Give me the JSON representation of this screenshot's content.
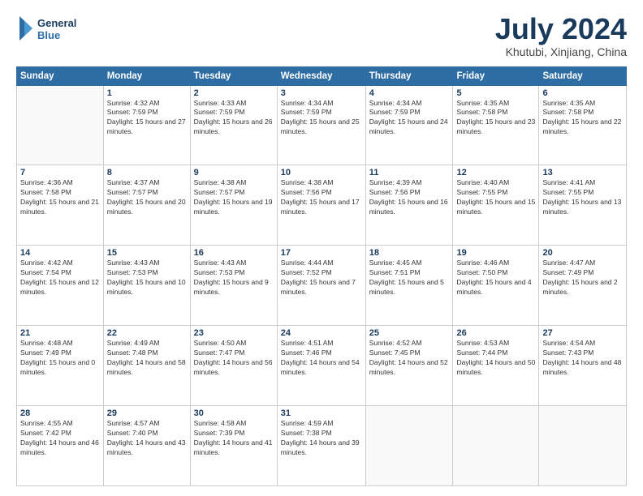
{
  "logo": {
    "line1": "General",
    "line2": "Blue"
  },
  "title": "July 2024",
  "subtitle": "Khutubi, Xinjiang, China",
  "weekdays": [
    "Sunday",
    "Monday",
    "Tuesday",
    "Wednesday",
    "Thursday",
    "Friday",
    "Saturday"
  ],
  "weeks": [
    [
      {
        "day": "",
        "sunrise": "",
        "sunset": "",
        "daylight": ""
      },
      {
        "day": "1",
        "sunrise": "Sunrise: 4:32 AM",
        "sunset": "Sunset: 7:59 PM",
        "daylight": "Daylight: 15 hours and 27 minutes."
      },
      {
        "day": "2",
        "sunrise": "Sunrise: 4:33 AM",
        "sunset": "Sunset: 7:59 PM",
        "daylight": "Daylight: 15 hours and 26 minutes."
      },
      {
        "day": "3",
        "sunrise": "Sunrise: 4:34 AM",
        "sunset": "Sunset: 7:59 PM",
        "daylight": "Daylight: 15 hours and 25 minutes."
      },
      {
        "day": "4",
        "sunrise": "Sunrise: 4:34 AM",
        "sunset": "Sunset: 7:59 PM",
        "daylight": "Daylight: 15 hours and 24 minutes."
      },
      {
        "day": "5",
        "sunrise": "Sunrise: 4:35 AM",
        "sunset": "Sunset: 7:58 PM",
        "daylight": "Daylight: 15 hours and 23 minutes."
      },
      {
        "day": "6",
        "sunrise": "Sunrise: 4:35 AM",
        "sunset": "Sunset: 7:58 PM",
        "daylight": "Daylight: 15 hours and 22 minutes."
      }
    ],
    [
      {
        "day": "7",
        "sunrise": "Sunrise: 4:36 AM",
        "sunset": "Sunset: 7:58 PM",
        "daylight": "Daylight: 15 hours and 21 minutes."
      },
      {
        "day": "8",
        "sunrise": "Sunrise: 4:37 AM",
        "sunset": "Sunset: 7:57 PM",
        "daylight": "Daylight: 15 hours and 20 minutes."
      },
      {
        "day": "9",
        "sunrise": "Sunrise: 4:38 AM",
        "sunset": "Sunset: 7:57 PM",
        "daylight": "Daylight: 15 hours and 19 minutes."
      },
      {
        "day": "10",
        "sunrise": "Sunrise: 4:38 AM",
        "sunset": "Sunset: 7:56 PM",
        "daylight": "Daylight: 15 hours and 17 minutes."
      },
      {
        "day": "11",
        "sunrise": "Sunrise: 4:39 AM",
        "sunset": "Sunset: 7:56 PM",
        "daylight": "Daylight: 15 hours and 16 minutes."
      },
      {
        "day": "12",
        "sunrise": "Sunrise: 4:40 AM",
        "sunset": "Sunset: 7:55 PM",
        "daylight": "Daylight: 15 hours and 15 minutes."
      },
      {
        "day": "13",
        "sunrise": "Sunrise: 4:41 AM",
        "sunset": "Sunset: 7:55 PM",
        "daylight": "Daylight: 15 hours and 13 minutes."
      }
    ],
    [
      {
        "day": "14",
        "sunrise": "Sunrise: 4:42 AM",
        "sunset": "Sunset: 7:54 PM",
        "daylight": "Daylight: 15 hours and 12 minutes."
      },
      {
        "day": "15",
        "sunrise": "Sunrise: 4:43 AM",
        "sunset": "Sunset: 7:53 PM",
        "daylight": "Daylight: 15 hours and 10 minutes."
      },
      {
        "day": "16",
        "sunrise": "Sunrise: 4:43 AM",
        "sunset": "Sunset: 7:53 PM",
        "daylight": "Daylight: 15 hours and 9 minutes."
      },
      {
        "day": "17",
        "sunrise": "Sunrise: 4:44 AM",
        "sunset": "Sunset: 7:52 PM",
        "daylight": "Daylight: 15 hours and 7 minutes."
      },
      {
        "day": "18",
        "sunrise": "Sunrise: 4:45 AM",
        "sunset": "Sunset: 7:51 PM",
        "daylight": "Daylight: 15 hours and 5 minutes."
      },
      {
        "day": "19",
        "sunrise": "Sunrise: 4:46 AM",
        "sunset": "Sunset: 7:50 PM",
        "daylight": "Daylight: 15 hours and 4 minutes."
      },
      {
        "day": "20",
        "sunrise": "Sunrise: 4:47 AM",
        "sunset": "Sunset: 7:49 PM",
        "daylight": "Daylight: 15 hours and 2 minutes."
      }
    ],
    [
      {
        "day": "21",
        "sunrise": "Sunrise: 4:48 AM",
        "sunset": "Sunset: 7:49 PM",
        "daylight": "Daylight: 15 hours and 0 minutes."
      },
      {
        "day": "22",
        "sunrise": "Sunrise: 4:49 AM",
        "sunset": "Sunset: 7:48 PM",
        "daylight": "Daylight: 14 hours and 58 minutes."
      },
      {
        "day": "23",
        "sunrise": "Sunrise: 4:50 AM",
        "sunset": "Sunset: 7:47 PM",
        "daylight": "Daylight: 14 hours and 56 minutes."
      },
      {
        "day": "24",
        "sunrise": "Sunrise: 4:51 AM",
        "sunset": "Sunset: 7:46 PM",
        "daylight": "Daylight: 14 hours and 54 minutes."
      },
      {
        "day": "25",
        "sunrise": "Sunrise: 4:52 AM",
        "sunset": "Sunset: 7:45 PM",
        "daylight": "Daylight: 14 hours and 52 minutes."
      },
      {
        "day": "26",
        "sunrise": "Sunrise: 4:53 AM",
        "sunset": "Sunset: 7:44 PM",
        "daylight": "Daylight: 14 hours and 50 minutes."
      },
      {
        "day": "27",
        "sunrise": "Sunrise: 4:54 AM",
        "sunset": "Sunset: 7:43 PM",
        "daylight": "Daylight: 14 hours and 48 minutes."
      }
    ],
    [
      {
        "day": "28",
        "sunrise": "Sunrise: 4:55 AM",
        "sunset": "Sunset: 7:42 PM",
        "daylight": "Daylight: 14 hours and 46 minutes."
      },
      {
        "day": "29",
        "sunrise": "Sunrise: 4:57 AM",
        "sunset": "Sunset: 7:40 PM",
        "daylight": "Daylight: 14 hours and 43 minutes."
      },
      {
        "day": "30",
        "sunrise": "Sunrise: 4:58 AM",
        "sunset": "Sunset: 7:39 PM",
        "daylight": "Daylight: 14 hours and 41 minutes."
      },
      {
        "day": "31",
        "sunrise": "Sunrise: 4:59 AM",
        "sunset": "Sunset: 7:38 PM",
        "daylight": "Daylight: 14 hours and 39 minutes."
      },
      {
        "day": "",
        "sunrise": "",
        "sunset": "",
        "daylight": ""
      },
      {
        "day": "",
        "sunrise": "",
        "sunset": "",
        "daylight": ""
      },
      {
        "day": "",
        "sunrise": "",
        "sunset": "",
        "daylight": ""
      }
    ]
  ]
}
